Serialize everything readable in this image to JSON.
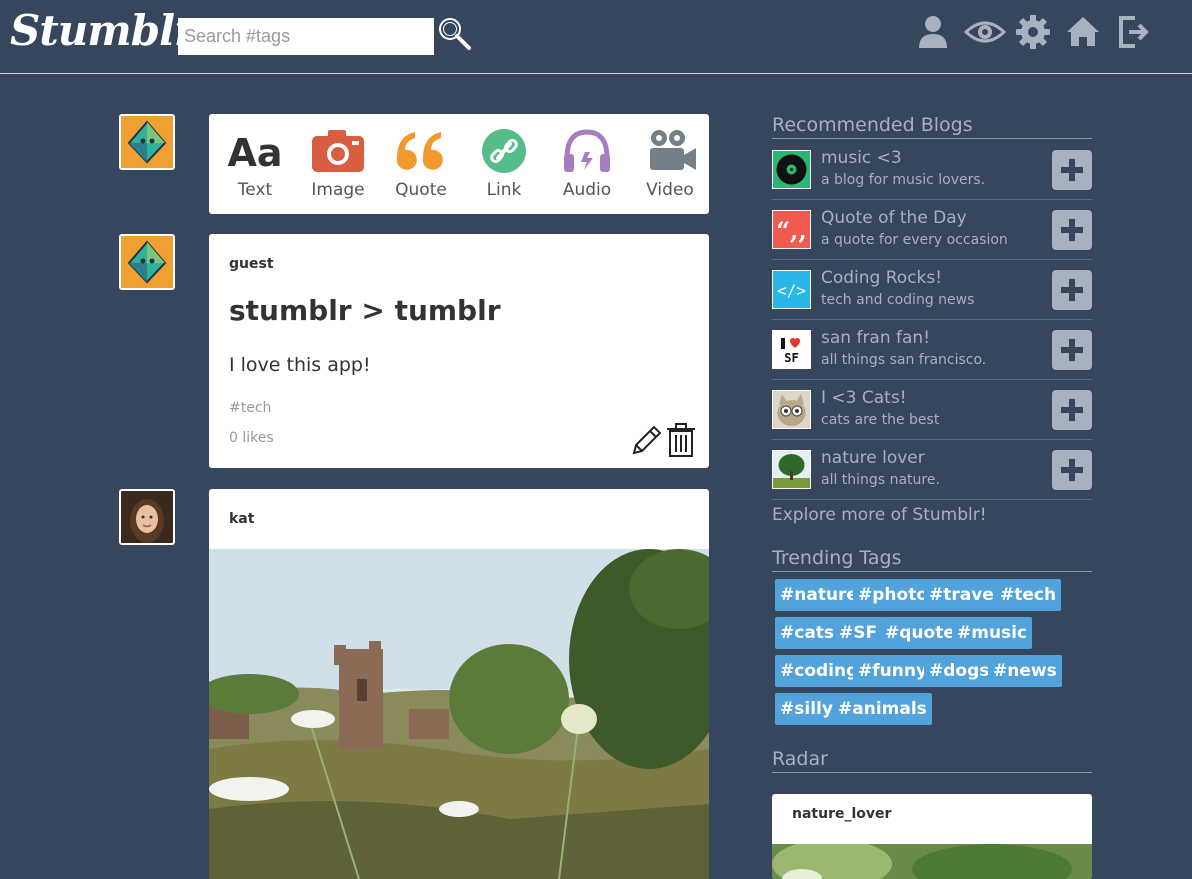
{
  "header": {
    "logo": "Stumblr",
    "search_placeholder": "Search #tags",
    "nav_icons": [
      "user-icon",
      "eye-icon",
      "gear-icon",
      "home-icon",
      "logout-icon"
    ]
  },
  "composer": {
    "types": [
      {
        "label": "Text",
        "icon": "text-icon",
        "color": "#333333"
      },
      {
        "label": "Image",
        "icon": "camera-icon",
        "color": "#d95e40"
      },
      {
        "label": "Quote",
        "icon": "quote-icon",
        "color": "#f2992e"
      },
      {
        "label": "Link",
        "icon": "link-icon",
        "color": "#56bc8a"
      },
      {
        "label": "Audio",
        "icon": "headphones-icon",
        "color": "#a77dc2"
      },
      {
        "label": "Video",
        "icon": "video-camera-icon",
        "color": "#748089"
      }
    ]
  },
  "posts": [
    {
      "author": "guest",
      "title": "stumblr > tumblr",
      "body": "I love this app!",
      "tag": "#tech",
      "likes": "0 likes"
    },
    {
      "author": "kat"
    }
  ],
  "sidebar": {
    "recommended_title": "Recommended Blogs",
    "recommended": [
      {
        "name": "music <3",
        "desc": "a blog for music lovers."
      },
      {
        "name": "Quote of the Day",
        "desc": "a quote for every occasion"
      },
      {
        "name": "Coding Rocks!",
        "desc": "tech and coding news"
      },
      {
        "name": "san fran fan!",
        "desc": "all things san francisco."
      },
      {
        "name": "I <3 Cats!",
        "desc": "cats are the best"
      },
      {
        "name": "nature lover",
        "desc": "all things nature."
      }
    ],
    "explore": "Explore more of Stumblr!",
    "trending_title": "Trending Tags",
    "tags": [
      "#nature",
      "#photo",
      "#travel",
      "#tech",
      "#cats",
      "#SF",
      "#quote",
      "#music",
      "#coding",
      "#funny",
      "#dogs",
      "#news",
      "#silly",
      "#animals"
    ],
    "radar_title": "Radar",
    "radar_author": "nature_lover"
  },
  "colors": {
    "background": "#36465d",
    "tag": "#52a2db",
    "muted_text": "#a6b0bf"
  }
}
